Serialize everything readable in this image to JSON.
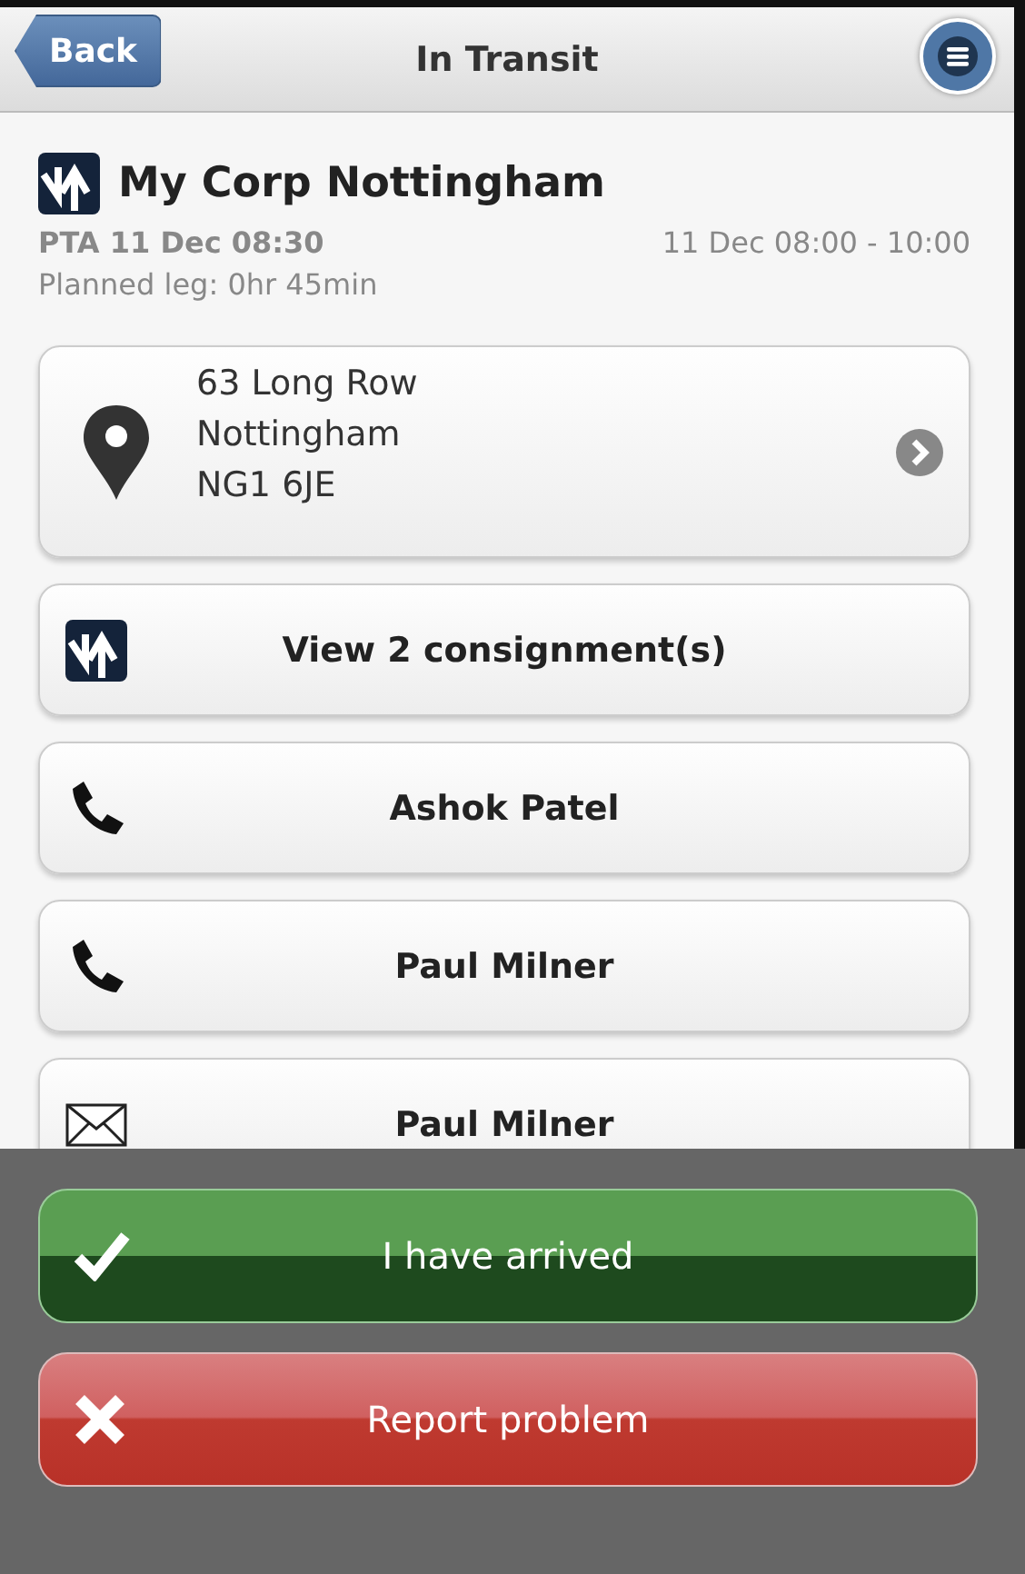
{
  "header": {
    "back": "Back",
    "title": "In Transit"
  },
  "stop": {
    "name": "My Corp Nottingham",
    "pta": "PTA 11 Dec 08:30",
    "window": "11 Dec 08:00 - 10:00",
    "leg": "Planned leg: 0hr 45min"
  },
  "address": {
    "lines": [
      "63 Long Row",
      "Nottingham",
      "NG1 6JE"
    ]
  },
  "actions": [
    {
      "kind": "consignments",
      "label": "View 2 consignment(s)"
    },
    {
      "kind": "phone",
      "label": "Ashok Patel"
    },
    {
      "kind": "phone",
      "label": "Paul Milner"
    },
    {
      "kind": "email",
      "label": "Paul Milner"
    }
  ],
  "footer": [
    {
      "kind": "confirm",
      "label": "I have arrived"
    },
    {
      "kind": "cancel",
      "label": "Report problem"
    }
  ]
}
